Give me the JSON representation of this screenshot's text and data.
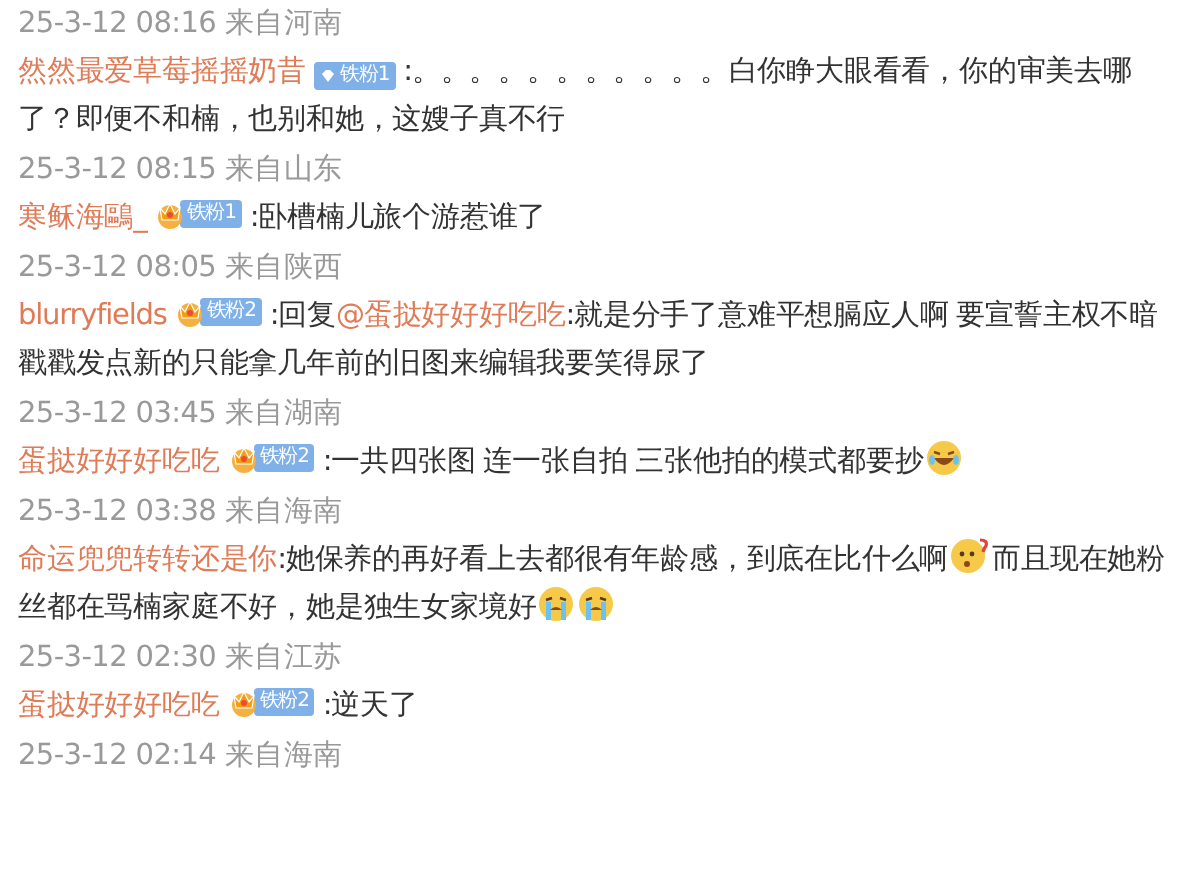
{
  "lead_time": "25-3-12 08:16 来自河南",
  "comments": [
    {
      "name": "然然最爱草莓摇摇奶昔",
      "badge": {
        "kind": "diamond",
        "label": "铁粉1"
      },
      "segments": [
        {
          "kind": "text",
          "text": ":。。。。。。。。。。。白你睁大眼看看，你的审美去哪了？即便不和楠，也别和她，这嫂子真不行"
        }
      ],
      "time": "25-3-12 08:15 来自山东"
    },
    {
      "name": "寒稣海鷗_",
      "badge": {
        "kind": "crown",
        "label": "铁粉1"
      },
      "segments": [
        {
          "kind": "text",
          "text": ":卧槽楠儿旅个游惹谁了"
        }
      ],
      "time": "25-3-12 08:05 来自陕西"
    },
    {
      "name": "blurryfields",
      "badge": {
        "kind": "crown",
        "label": "铁粉2"
      },
      "segments": [
        {
          "kind": "text",
          "text": ":回复"
        },
        {
          "kind": "mention",
          "text": "@蛋挞好好好吃吃"
        },
        {
          "kind": "text",
          "text": ":就是分手了意难平想膈应人啊 要宣誓主权不暗戳戳发点新的只能拿几年前的旧图来编辑我要笑得尿了"
        }
      ],
      "time": "25-3-12 03:45 来自湖南"
    },
    {
      "name": "蛋挞好好好吃吃",
      "badge": {
        "kind": "crown",
        "label": "铁粉2"
      },
      "segments": [
        {
          "kind": "text",
          "text": ":一共四张图 连一张自拍 三张他拍的模式都要抄"
        },
        {
          "kind": "laugh"
        }
      ],
      "time": "25-3-12 03:38 来自海南"
    },
    {
      "name": "命运兜兜转转还是你",
      "segments": [
        {
          "kind": "text",
          "text": ":她保养的再好看上去都很有年龄感，到底在比什么啊"
        },
        {
          "kind": "doubt"
        },
        {
          "kind": "text",
          "text": "而且现在她粉丝都在骂楠家庭不好，她是独生女家境好"
        },
        {
          "kind": "cry"
        },
        {
          "kind": "cry"
        }
      ],
      "time": "25-3-12 02:30 来自江苏"
    },
    {
      "name": "蛋挞好好好吃吃",
      "badge": {
        "kind": "crown",
        "label": "铁粉2"
      },
      "segments": [
        {
          "kind": "text",
          "text": ":逆天了"
        }
      ],
      "time": "25-3-12 02:14 来自海南"
    }
  ]
}
